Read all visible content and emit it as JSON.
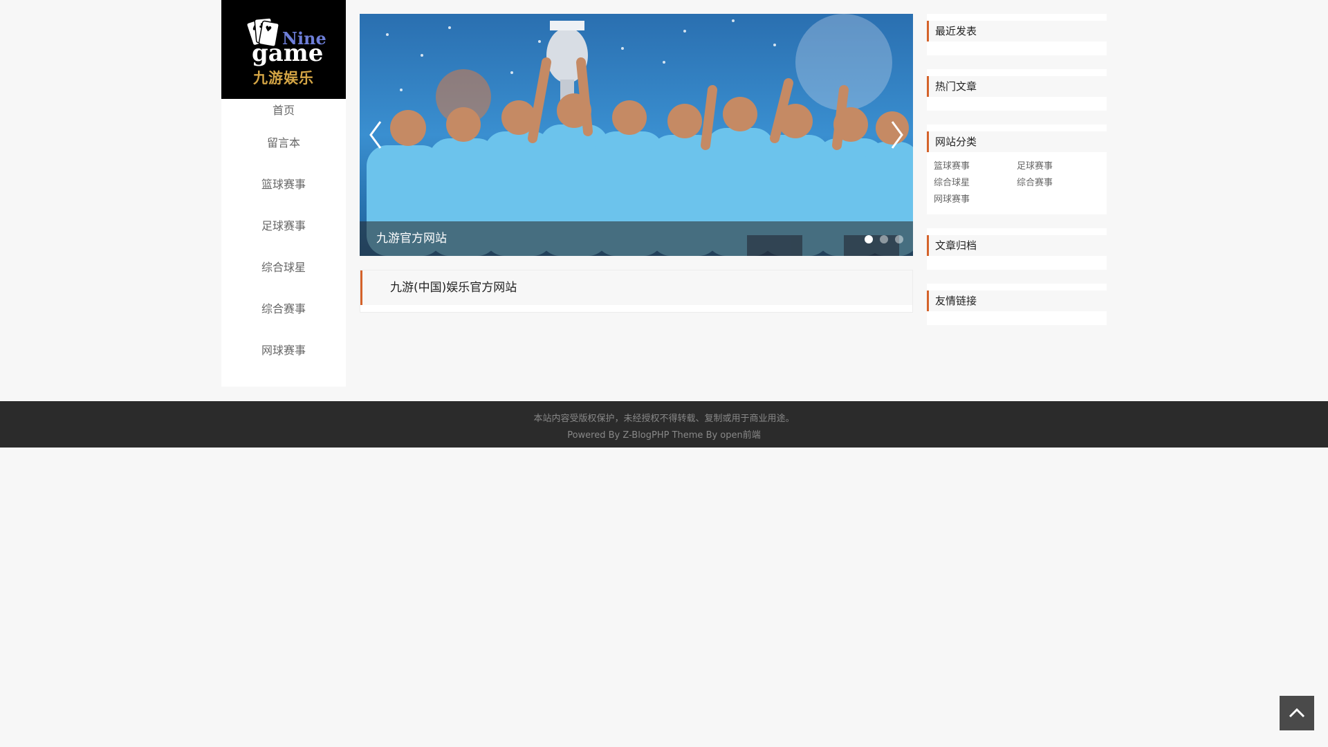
{
  "logo": {
    "english_top": "Nine",
    "english_bottom": "game",
    "chinese": "九游娱乐"
  },
  "nav": [
    "首页",
    "留言本",
    "篮球赛事",
    "足球赛事",
    "综合球星",
    "综合赛事",
    "网球赛事"
  ],
  "slider": {
    "caption": "九游官方网站",
    "dot_count": 3,
    "active_dot": 0
  },
  "post": {
    "title": "九游(中国)娱乐官方网站"
  },
  "widgets": {
    "recent": {
      "title": "最近发表"
    },
    "hot": {
      "title": "热门文章"
    },
    "categories": {
      "title": "网站分类",
      "items": [
        "篮球赛事",
        "足球赛事",
        "综合球星",
        "综合赛事",
        "网球赛事"
      ]
    },
    "archive": {
      "title": "文章归档"
    },
    "links": {
      "title": "友情链接"
    }
  },
  "footer": {
    "line1": "本站内容受版权保护，未经授权不得转载、复制或用于商业用途。",
    "line2": "Powered By Z-BlogPHP Theme By open前端"
  },
  "colors": {
    "accent": "#d4622a",
    "footer_bg": "#2b2b2b",
    "jersey": "#6cc3ec"
  }
}
